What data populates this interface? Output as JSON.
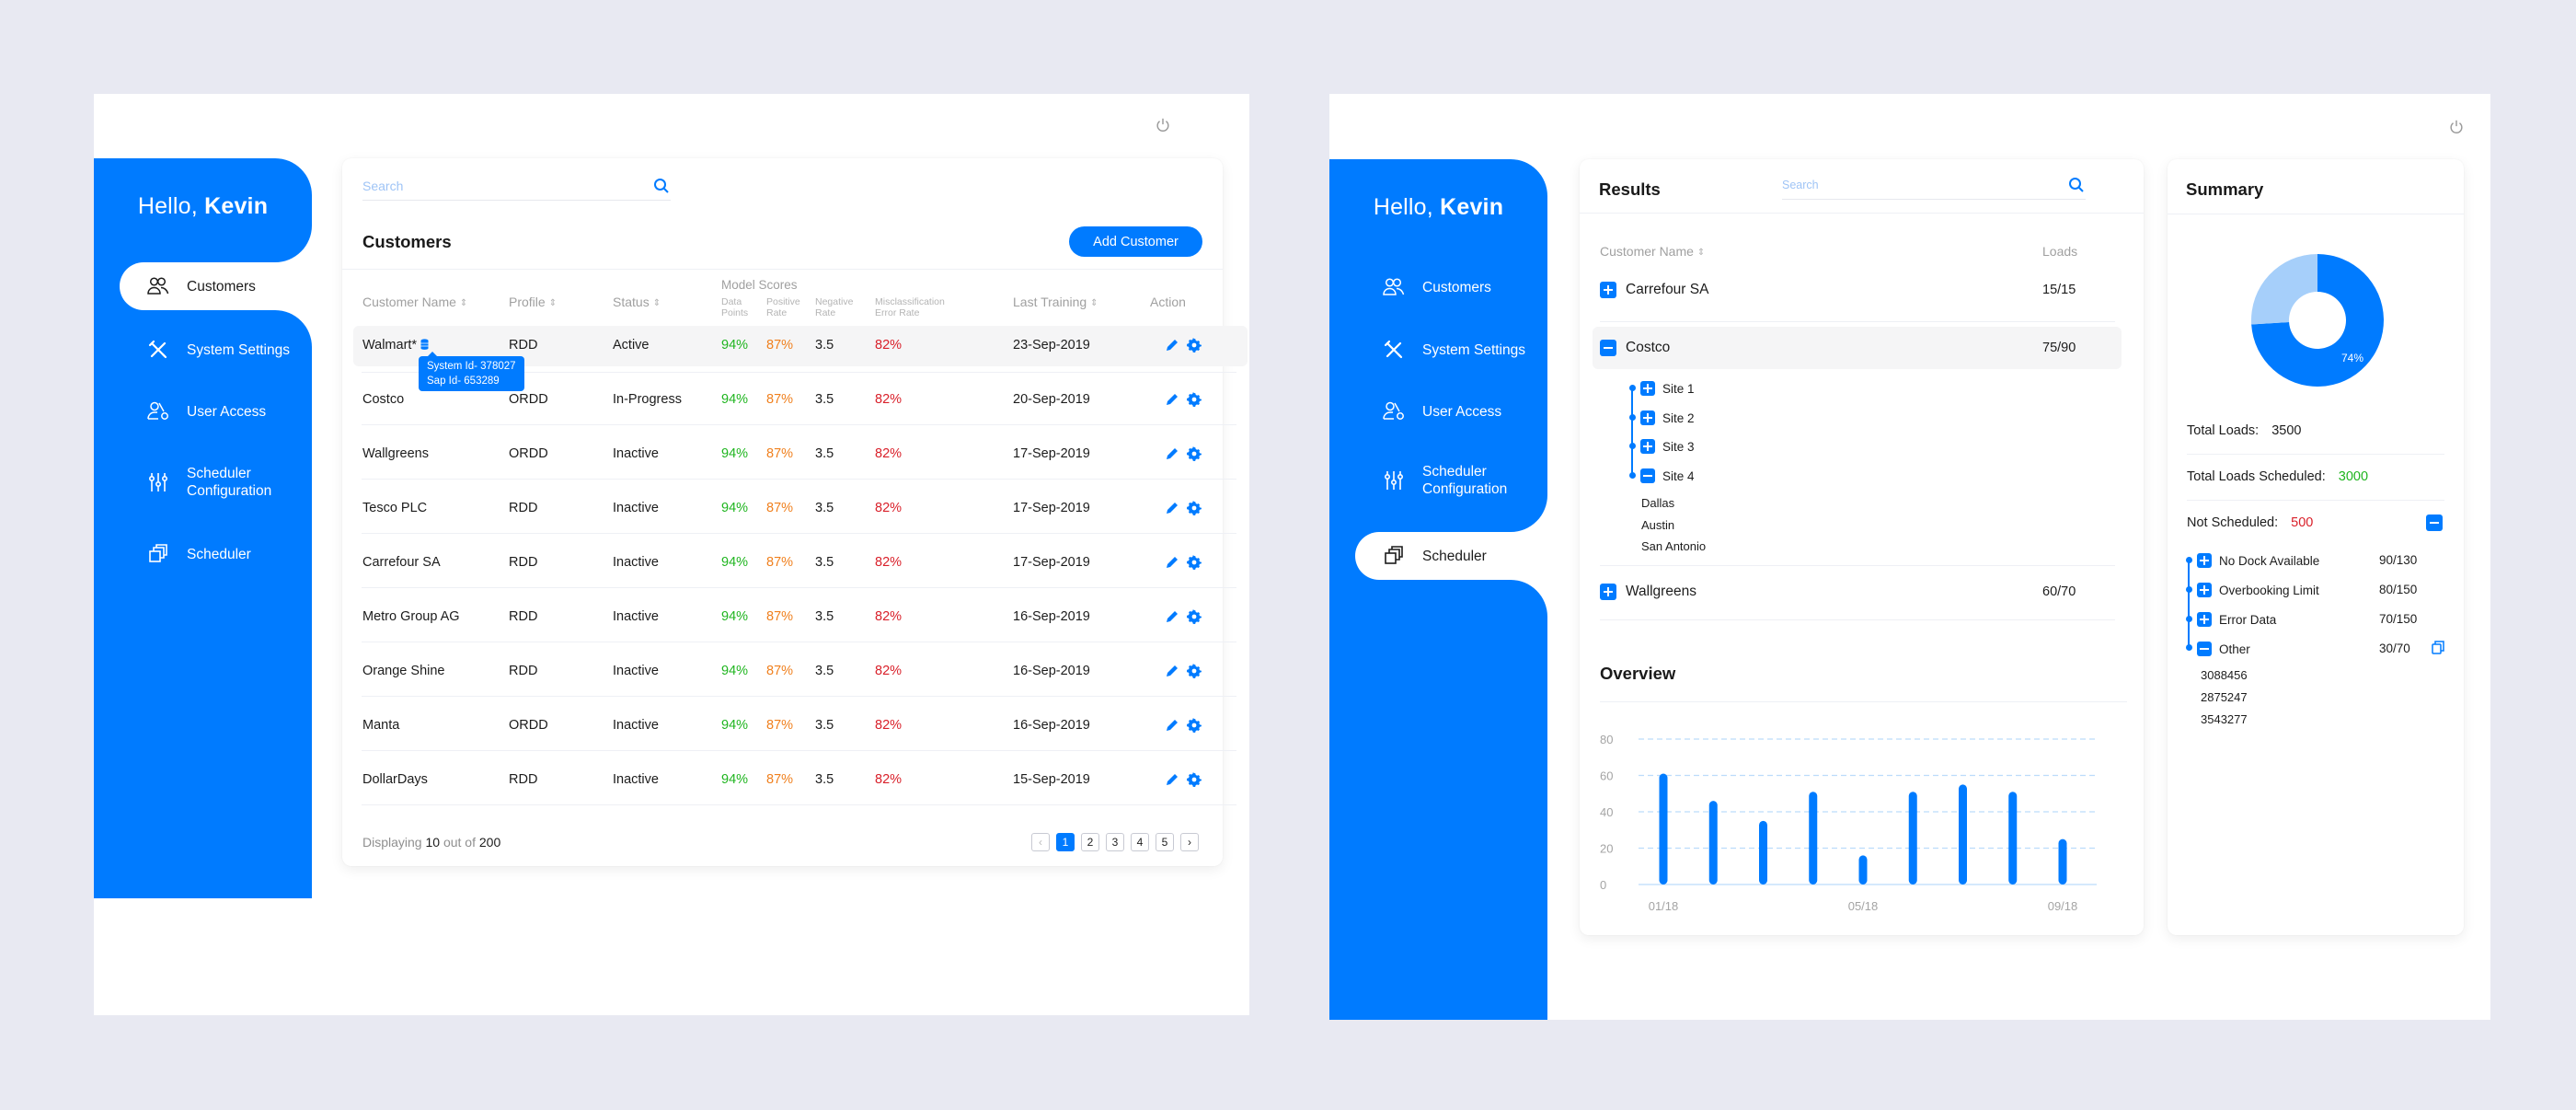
{
  "colors": {
    "primary": "#007bff",
    "green": "#1fb51f",
    "orange": "#f0801e",
    "red": "#d9202a",
    "light_blue": "#a6cffa"
  },
  "left_screen": {
    "greeting": {
      "hello": "Hello,",
      "name": "Kevin"
    },
    "nav": [
      {
        "label": "Customers",
        "icon": "users-icon",
        "active": true
      },
      {
        "label": "System Settings",
        "icon": "tools-icon",
        "active": false
      },
      {
        "label": "User Access",
        "icon": "user-key-icon",
        "active": false
      },
      {
        "label": "Scheduler Configuration",
        "icon": "sliders-icon",
        "active": false
      },
      {
        "label": "Scheduler",
        "icon": "copy-stack-icon",
        "active": false
      }
    ],
    "search": {
      "placeholder": "Search",
      "value": ""
    },
    "title": "Customers",
    "add_button": "Add Customer",
    "columns": {
      "customer_name": "Customer Name",
      "profile": "Profile",
      "status": "Status",
      "model_scores": "Model Scores",
      "data_points": "Data Points",
      "positive_rate": "Positive Rate",
      "negative_rate": "Negative Rate",
      "misclassification": "Misclassification Error Rate",
      "last_training": "Last Training",
      "action": "Action"
    },
    "rows": [
      {
        "name": "Walmart*",
        "profile": "RDD",
        "status": "Active",
        "data_points": "94%",
        "positive_rate": "87%",
        "negative_rate": "3.5",
        "error_rate": "82%",
        "last_training": "23-Sep-2019"
      },
      {
        "name": "Costco",
        "profile": "ORDD",
        "status": "In-Progress",
        "data_points": "94%",
        "positive_rate": "87%",
        "negative_rate": "3.5",
        "error_rate": "82%",
        "last_training": "20-Sep-2019"
      },
      {
        "name": "Wallgreens",
        "profile": "ORDD",
        "status": "Inactive",
        "data_points": "94%",
        "positive_rate": "87%",
        "negative_rate": "3.5",
        "error_rate": "82%",
        "last_training": "17-Sep-2019"
      },
      {
        "name": "Tesco PLC",
        "profile": "RDD",
        "status": "Inactive",
        "data_points": "94%",
        "positive_rate": "87%",
        "negative_rate": "3.5",
        "error_rate": "82%",
        "last_training": "17-Sep-2019"
      },
      {
        "name": "Carrefour SA",
        "profile": "RDD",
        "status": "Inactive",
        "data_points": "94%",
        "positive_rate": "87%",
        "negative_rate": "3.5",
        "error_rate": "82%",
        "last_training": "17-Sep-2019"
      },
      {
        "name": "Metro Group AG",
        "profile": "RDD",
        "status": "Inactive",
        "data_points": "94%",
        "positive_rate": "87%",
        "negative_rate": "3.5",
        "error_rate": "82%",
        "last_training": "16-Sep-2019"
      },
      {
        "name": "Orange Shine",
        "profile": "RDD",
        "status": "Inactive",
        "data_points": "94%",
        "positive_rate": "87%",
        "negative_rate": "3.5",
        "error_rate": "82%",
        "last_training": "16-Sep-2019"
      },
      {
        "name": "Manta",
        "profile": "ORDD",
        "status": "Inactive",
        "data_points": "94%",
        "positive_rate": "87%",
        "negative_rate": "3.5",
        "error_rate": "82%",
        "last_training": "16-Sep-2019"
      },
      {
        "name": "DollarDays",
        "profile": "RDD",
        "status": "Inactive",
        "data_points": "94%",
        "positive_rate": "87%",
        "negative_rate": "3.5",
        "error_rate": "82%",
        "last_training": "15-Sep-2019"
      }
    ],
    "tooltip": {
      "system_id": "System Id- 378027",
      "sap_id": "Sap Id- 653289"
    },
    "footer": {
      "prefix": "Displaying",
      "shown": "10",
      "middle": "out of",
      "total": "200"
    },
    "pagination": {
      "prev": "‹",
      "pages": [
        "1",
        "2",
        "3",
        "4",
        "5"
      ],
      "current": "1",
      "next": "›"
    }
  },
  "right_screen": {
    "greeting": {
      "hello": "Hello,",
      "name": "Kevin"
    },
    "nav": [
      {
        "label": "Customers",
        "icon": "users-icon",
        "active": false
      },
      {
        "label": "System Settings",
        "icon": "tools-icon",
        "active": false
      },
      {
        "label": "User Access",
        "icon": "user-key-icon",
        "active": false
      },
      {
        "label": "Scheduler Configuration",
        "icon": "sliders-icon",
        "active": false
      },
      {
        "label": "Scheduler",
        "icon": "copy-stack-icon",
        "active": true
      }
    ],
    "results": {
      "title": "Results",
      "search": {
        "placeholder": "Search",
        "value": ""
      },
      "col_customer": "Customer Name",
      "col_loads": "Loads",
      "customers": [
        {
          "name": "Carrefour SA",
          "loads": "15/15",
          "expanded": false
        },
        {
          "name": "Costco",
          "loads": "75/90",
          "expanded": true,
          "sites": [
            {
              "name": "Site 1",
              "expanded": false
            },
            {
              "name": "Site 2",
              "expanded": false
            },
            {
              "name": "Site 3",
              "expanded": false
            },
            {
              "name": "Site 4",
              "expanded": true
            }
          ],
          "locations": [
            "Dallas",
            "Austin",
            "San Antonio"
          ]
        },
        {
          "name": "Wallgreens",
          "loads": "60/70",
          "expanded": false
        }
      ]
    },
    "overview": {
      "title": "Overview"
    },
    "summary": {
      "title": "Summary",
      "donut_percent": "74%",
      "donut_value": 0.74,
      "total_loads_label": "Total Loads:",
      "total_loads": "3500",
      "scheduled_label": "Total Loads Scheduled:",
      "scheduled": "3000",
      "not_scheduled_label": "Not Scheduled:",
      "not_scheduled": "500",
      "reasons": [
        {
          "name": "No Dock Available",
          "value": "90/130",
          "expanded": false,
          "alert": false
        },
        {
          "name": "Overbooking Limit",
          "value": "80/150",
          "expanded": false,
          "alert": false
        },
        {
          "name": "Error Data",
          "value": "70/150",
          "expanded": false,
          "alert": false
        },
        {
          "name": "Other",
          "value": "30/70",
          "expanded": true,
          "alert": true
        }
      ],
      "other_ids": [
        "3088456",
        "2875247",
        "3543277"
      ]
    }
  },
  "chart_data": {
    "type": "bar",
    "title": "Overview",
    "categories": [
      "01/18",
      "02/18",
      "03/18",
      "04/18",
      "05/18",
      "06/18",
      "07/18",
      "08/18",
      "09/18"
    ],
    "values": [
      61,
      46,
      35,
      51,
      16,
      51,
      55,
      51,
      25
    ],
    "xtick_labels": [
      "01/18",
      "05/18",
      "09/18"
    ],
    "yticks": [
      0,
      20,
      40,
      60,
      80
    ],
    "ylim": [
      0,
      80
    ],
    "xlabel": "",
    "ylabel": "",
    "grid": true,
    "legend": "none"
  }
}
